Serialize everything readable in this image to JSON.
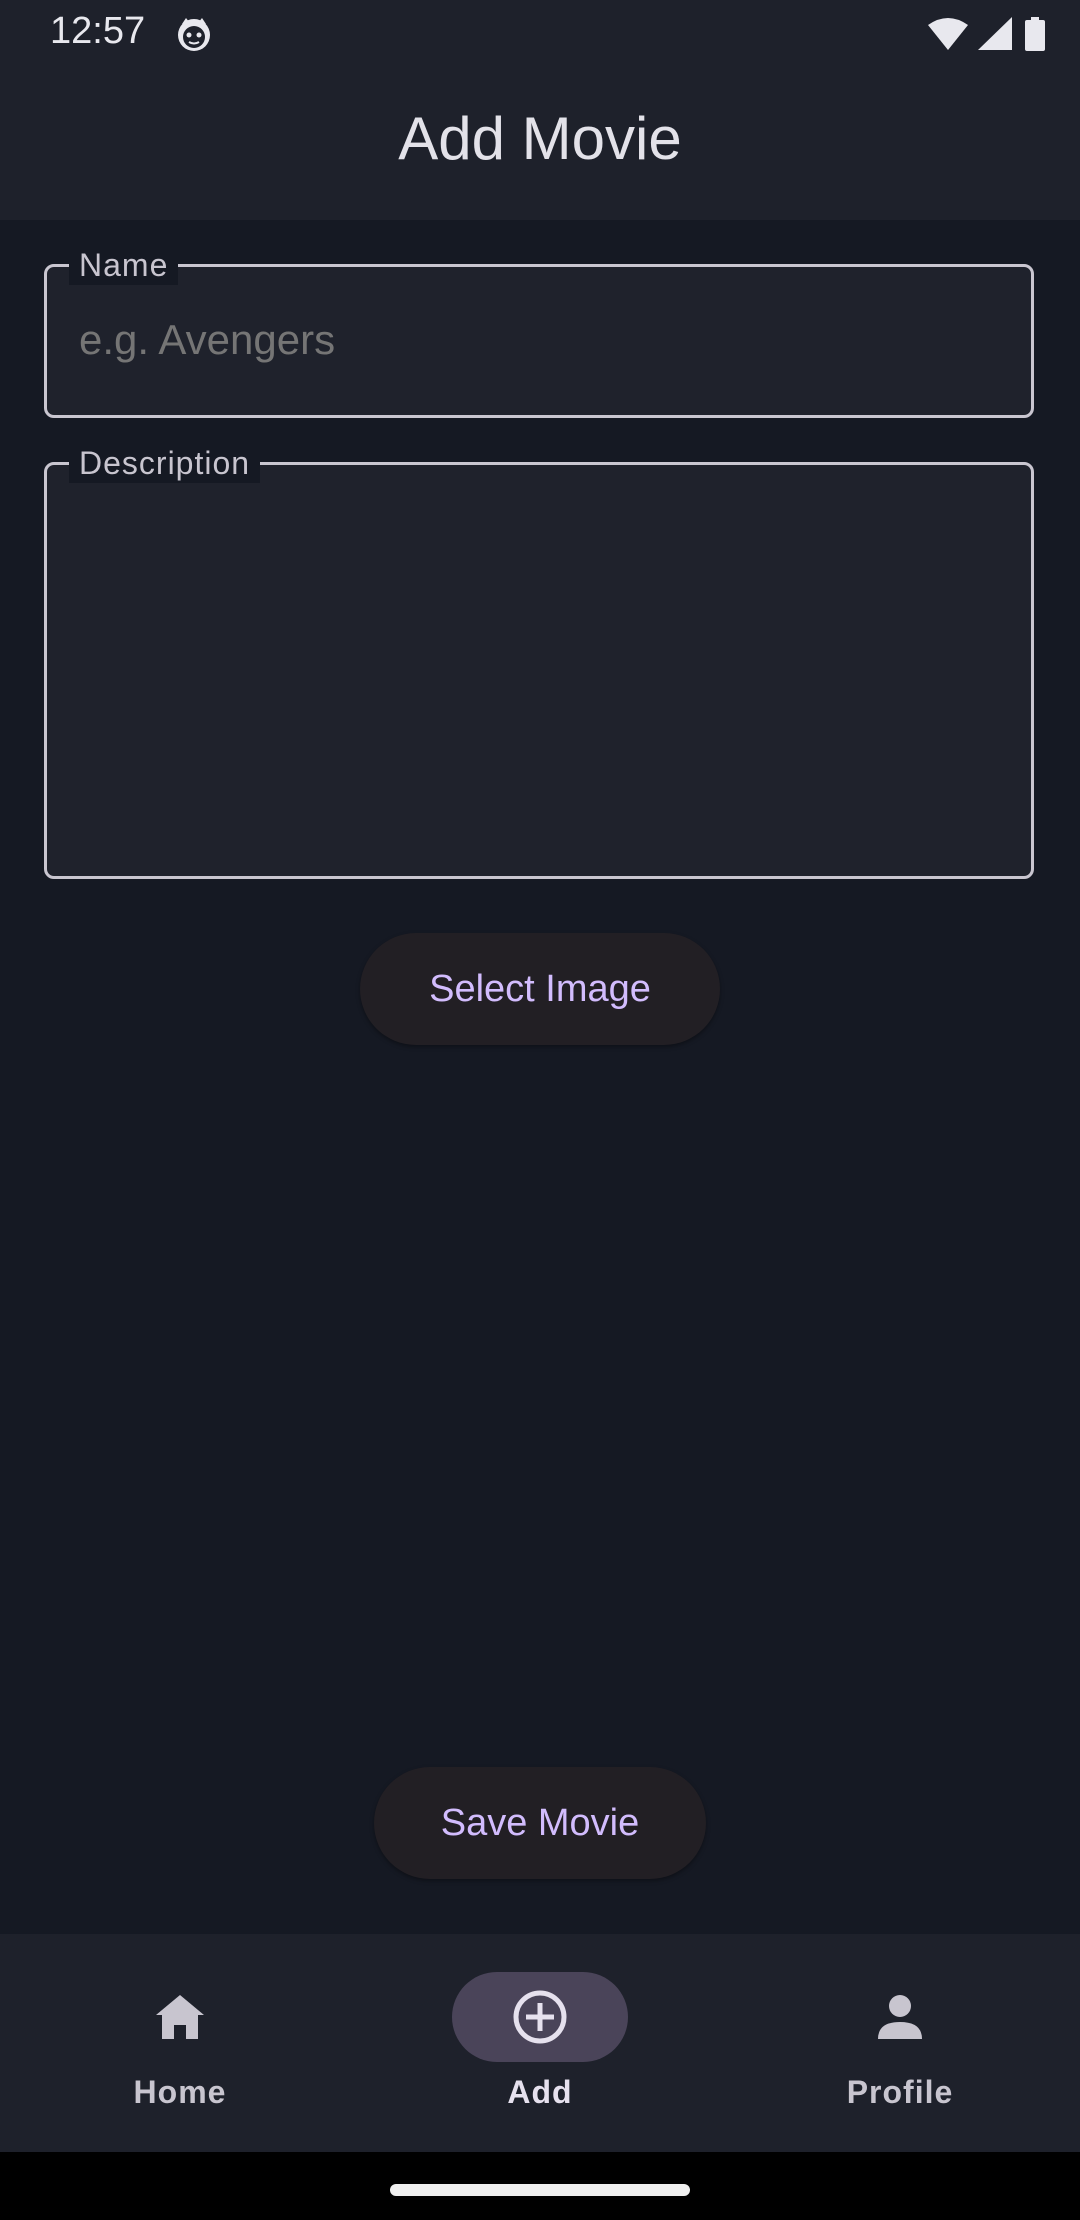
{
  "status_bar": {
    "time": "12:57",
    "icons": [
      "cat-notification-icon",
      "wifi-icon",
      "signal-icon",
      "battery-icon"
    ]
  },
  "app_bar": {
    "title": "Add Movie"
  },
  "form": {
    "name_label": "Name",
    "name_placeholder": "e.g. Avengers",
    "name_value": "",
    "description_label": "Description",
    "description_value": ""
  },
  "buttons": {
    "select_image": "Select Image",
    "save_movie": "Save Movie"
  },
  "bottom_nav": {
    "items": [
      {
        "label": "Home",
        "icon": "home-icon",
        "active": false
      },
      {
        "label": "Add",
        "icon": "add-circle-icon",
        "active": true
      },
      {
        "label": "Profile",
        "icon": "person-icon",
        "active": false
      }
    ]
  },
  "colors": {
    "background": "#151923",
    "surface": "#1e212b",
    "accent_text": "#d2bcfd",
    "active_indicator": "#4a4459"
  }
}
